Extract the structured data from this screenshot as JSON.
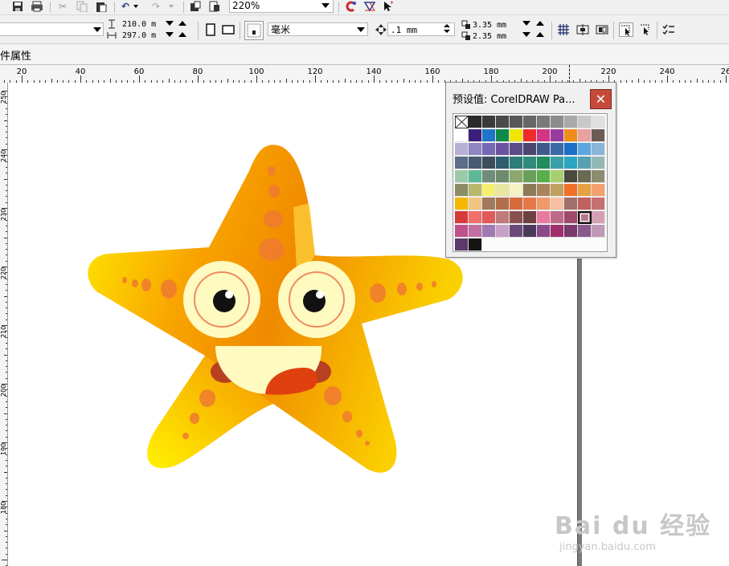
{
  "toolbar": {
    "zoom": "220%",
    "icons": [
      "save-icon",
      "print-icon",
      "cut-icon",
      "copy-icon",
      "paste-icon",
      "undo-icon",
      "redo-icon",
      "import-icon",
      "export-icon",
      "app-launcher-icon",
      "welcome-icon",
      "snap-icon"
    ]
  },
  "property_bar": {
    "page_width": "210.0 m",
    "page_height": "297.0 m",
    "units": "毫米",
    "nudge": ".1 mm",
    "dup_x": "3.35 mm",
    "dup_y": "2.35 mm"
  },
  "docbar": {
    "label": "件属性"
  },
  "rulers": {
    "h_labels": [
      "20",
      "40",
      "60",
      "80",
      "100",
      "120",
      "140",
      "160",
      "180",
      "200",
      "220",
      "240",
      "26"
    ],
    "v_labels": [
      "250",
      "240",
      "230",
      "220",
      "210",
      "200",
      "190",
      "180"
    ]
  },
  "palette": {
    "title": "预设值: CorelDRAW Pa...",
    "close_label": "✕",
    "selected_index": 86,
    "colors": [
      "none",
      "#2b2b2b",
      "#3a3a3a",
      "#4a4a4a",
      "#585858",
      "#676767",
      "#7a7a7a",
      "#8c8c8c",
      "#a9a9a9",
      "#c8c8c8",
      "#e0e0e0",
      "#ffffff",
      "#3b1f7a",
      "#1e74c9",
      "#0f8a48",
      "#f2e600",
      "#ef2b2b",
      "#d43484",
      "#9a3a9e",
      "#f08c1a",
      "#e9a0a0",
      "#6a5c55",
      "#b9b0d6",
      "#8d86c0",
      "#7369b6",
      "#6e52a2",
      "#5c4b86",
      "#4a4670",
      "#3f5a8a",
      "#3a6aa8",
      "#1e6ec8",
      "#5aa6e0",
      "#8ab4d8",
      "#5b6d8a",
      "#475a70",
      "#3c4e5e",
      "#2d5e6e",
      "#2e7c7a",
      "#2f8c7a",
      "#218c5e",
      "#3aa0a8",
      "#2aa6c2",
      "#56a0b0",
      "#93b8b4",
      "#9cc9a8",
      "#5cb896",
      "#718c7a",
      "#6e8a6c",
      "#8ba86a",
      "#6aa05a",
      "#58b04a",
      "#a6d070",
      "#4a4a3c",
      "#6a6a54",
      "#8c8c70",
      "#8c8c66",
      "#b8b86a",
      "#f6f070",
      "#e8e6a0",
      "#f6f2c4",
      "#8c7a58",
      "#a8845c",
      "#c2a060",
      "#f07028",
      "#e8a040",
      "#f2a070",
      "#f4b800",
      "#f2c482",
      "#a07a5c",
      "#b0704c",
      "#d66c3c",
      "#e87848",
      "#f09a6a",
      "#f8c0a0",
      "#a0706a",
      "#c06060",
      "#c87070",
      "#d83a3a",
      "#f06e6e",
      "#e05a5a",
      "#c07a7a",
      "#8a5050",
      "#6e4040",
      "#e87aa0",
      "#c06a8a",
      "#a04a6a",
      "#b27a8a",
      "#d6a0b4",
      "#c0508a",
      "#c070a0",
      "#a07ab0",
      "#c8a0c8",
      "#6a4a7a",
      "#4a3a5a",
      "#8a4a8a",
      "#a0306a",
      "#7a3a6a",
      "#8a5a8a",
      "#c098b8",
      "#5a3a6a",
      "#141414"
    ]
  },
  "watermark": {
    "brand": "Bai du 经验",
    "url": "jingyan.baidu.com"
  }
}
